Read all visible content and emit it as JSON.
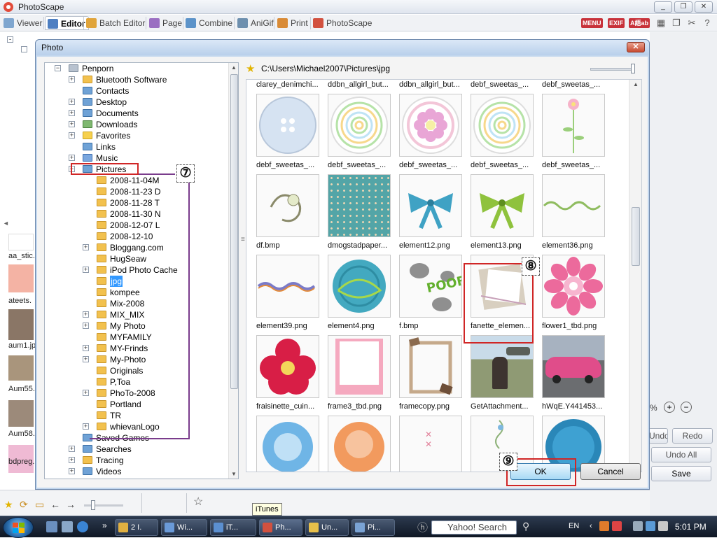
{
  "app": {
    "title": "PhotoScape",
    "window_controls": [
      "_",
      "❐",
      "✕"
    ]
  },
  "toolbar": {
    "tabs": [
      {
        "label": "Viewer",
        "active": false
      },
      {
        "label": "Editor",
        "active": true
      },
      {
        "label": "Batch Editor",
        "active": false
      },
      {
        "label": "Page",
        "active": false
      },
      {
        "label": "Combine",
        "active": false
      },
      {
        "label": "AniGif",
        "active": false
      },
      {
        "label": "Print",
        "active": false
      },
      {
        "label": "PhotoScape",
        "active": false
      }
    ],
    "right_badges": [
      "MENU",
      "EXIF",
      "A語ab"
    ]
  },
  "background": {
    "left_thumbnails": [
      "aa_stic.",
      "ateets.",
      "aum1.jp",
      "Aum55.",
      "Aum58.",
      "bdpreg."
    ],
    "right_buttons": {
      "undo": "Undo",
      "redo": "Redo",
      "undo_all": "Undo All",
      "save": "Save"
    },
    "zoom_pct": "%"
  },
  "dialog": {
    "title": "Photo",
    "close": "✕",
    "path": "C:\\Users\\Michael2007\\Pictures\\jpg",
    "ok": "OK",
    "cancel": "Cancel"
  },
  "tree": [
    {
      "label": "Penporn",
      "icon": "user-folder",
      "indent": 0,
      "expander": "-"
    },
    {
      "label": "Bluetooth Software",
      "icon": "folder",
      "indent": 1,
      "expander": "+"
    },
    {
      "label": "Contacts",
      "icon": "folder-blue",
      "indent": 1,
      "expander": ""
    },
    {
      "label": "Desktop",
      "icon": "folder-blue",
      "indent": 1,
      "expander": "+"
    },
    {
      "label": "Documents",
      "icon": "folder-blue",
      "indent": 1,
      "expander": "+"
    },
    {
      "label": "Downloads",
      "icon": "folder-green",
      "indent": 1,
      "expander": "+"
    },
    {
      "label": "Favorites",
      "icon": "folder-star",
      "indent": 1,
      "expander": "+"
    },
    {
      "label": "Links",
      "icon": "folder-blue",
      "indent": 1,
      "expander": ""
    },
    {
      "label": "Music",
      "icon": "folder-music",
      "indent": 1,
      "expander": "+"
    },
    {
      "label": "Pictures",
      "icon": "folder-blue",
      "indent": 1,
      "expander": "-"
    },
    {
      "label": "2008-11-04M",
      "icon": "folder",
      "indent": 2,
      "expander": ""
    },
    {
      "label": "2008-11-23 D",
      "icon": "folder",
      "indent": 2,
      "expander": ""
    },
    {
      "label": "2008-11-28 T",
      "icon": "folder",
      "indent": 2,
      "expander": ""
    },
    {
      "label": "2008-11-30 N",
      "icon": "folder",
      "indent": 2,
      "expander": ""
    },
    {
      "label": "2008-12-07 L",
      "icon": "folder",
      "indent": 2,
      "expander": ""
    },
    {
      "label": "2008-12-10",
      "icon": "folder",
      "indent": 2,
      "expander": ""
    },
    {
      "label": "Bloggang.com",
      "icon": "folder",
      "indent": 2,
      "expander": "+"
    },
    {
      "label": "HugSeaw",
      "icon": "folder",
      "indent": 2,
      "expander": ""
    },
    {
      "label": "iPod Photo Cache",
      "icon": "folder",
      "indent": 2,
      "expander": "+"
    },
    {
      "label": "jpg",
      "icon": "folder",
      "indent": 2,
      "expander": "",
      "selected": true
    },
    {
      "label": "kompee",
      "icon": "folder",
      "indent": 2,
      "expander": ""
    },
    {
      "label": "Mix-2008",
      "icon": "folder",
      "indent": 2,
      "expander": ""
    },
    {
      "label": "MIX_MIX",
      "icon": "folder",
      "indent": 2,
      "expander": "+"
    },
    {
      "label": "My Photo",
      "icon": "folder",
      "indent": 2,
      "expander": "+"
    },
    {
      "label": "MYFAMILY",
      "icon": "folder",
      "indent": 2,
      "expander": ""
    },
    {
      "label": "MY-Frinds",
      "icon": "folder",
      "indent": 2,
      "expander": "+"
    },
    {
      "label": "My-Photo",
      "icon": "folder",
      "indent": 2,
      "expander": "+"
    },
    {
      "label": "Originals",
      "icon": "folder",
      "indent": 2,
      "expander": ""
    },
    {
      "label": "P,Toa",
      "icon": "folder",
      "indent": 2,
      "expander": ""
    },
    {
      "label": "PhoTo-2008",
      "icon": "folder",
      "indent": 2,
      "expander": "+"
    },
    {
      "label": "Portland",
      "icon": "folder",
      "indent": 2,
      "expander": ""
    },
    {
      "label": "TR",
      "icon": "folder",
      "indent": 2,
      "expander": ""
    },
    {
      "label": "whievanLogo",
      "icon": "folder",
      "indent": 2,
      "expander": "+"
    },
    {
      "label": "Saved Games",
      "icon": "folder-blue",
      "indent": 1,
      "expander": ""
    },
    {
      "label": "Searches",
      "icon": "folder-blue",
      "indent": 1,
      "expander": "+"
    },
    {
      "label": "Tracing",
      "icon": "folder",
      "indent": 1,
      "expander": "+"
    },
    {
      "label": "Videos",
      "icon": "folder-blue",
      "indent": 1,
      "expander": "+"
    }
  ],
  "files": [
    {
      "name": "clarey_denimchi...",
      "art": "partial-top"
    },
    {
      "name": "ddbn_allgirl_but...",
      "art": "partial-top"
    },
    {
      "name": "ddbn_allgirl_but...",
      "art": "partial-top"
    },
    {
      "name": "debf_sweetas_...",
      "art": "partial-top"
    },
    {
      "name": "debf_sweetas_...",
      "art": "partial-top"
    },
    {
      "name": "debf_sweetas_...",
      "art": "button-blue"
    },
    {
      "name": "debf_sweetas_...",
      "art": "button-rings"
    },
    {
      "name": "debf_sweetas_...",
      "art": "button-flower"
    },
    {
      "name": "debf_sweetas_...",
      "art": "button-rings"
    },
    {
      "name": "debf_sweetas_...",
      "art": "flower-stem"
    },
    {
      "name": "df.bmp",
      "art": "charm"
    },
    {
      "name": "dmogstadpaper...",
      "art": "polka-teal"
    },
    {
      "name": "element12.png",
      "art": "bow-blue"
    },
    {
      "name": "element13.png",
      "art": "bow-green"
    },
    {
      "name": "element36.png",
      "art": "ribbon-green"
    },
    {
      "name": "element39.png",
      "art": "ribbon-multi"
    },
    {
      "name": "element4.png",
      "art": "button-teal"
    },
    {
      "name": "f.bmp",
      "art": "poof"
    },
    {
      "name": "fanette_elemen...",
      "art": "frame-tilted",
      "highlight": true
    },
    {
      "name": "flower1_tbd.png",
      "art": "flower-pink"
    },
    {
      "name": "fraisinette_cuin...",
      "art": "flower-red"
    },
    {
      "name": "frame3_tbd.png",
      "art": "frame-pink"
    },
    {
      "name": "framecopy.png",
      "art": "frame-brown"
    },
    {
      "name": "GetAttachment...",
      "art": "photo-man"
    },
    {
      "name": "hWqE.Y441453...",
      "art": "photo-car"
    },
    {
      "name": "",
      "art": "partial-blue"
    },
    {
      "name": "",
      "art": "partial-orange"
    },
    {
      "name": "",
      "art": "partial-x"
    },
    {
      "name": "",
      "art": "partial-vine"
    },
    {
      "name": "",
      "art": "partial-blue-button"
    }
  ],
  "annotations": {
    "step7": "⑦",
    "step8": "⑧",
    "step9": "⑨"
  },
  "tooltip": "iTunes",
  "taskbar": {
    "tasks": [
      "2 I.",
      "Wi...",
      "iT...",
      "Ph...",
      "Un...",
      "Pi..."
    ],
    "active_index": 3,
    "search": "Yahoo! Search",
    "lang": "EN",
    "clock": "5:01 PM"
  }
}
